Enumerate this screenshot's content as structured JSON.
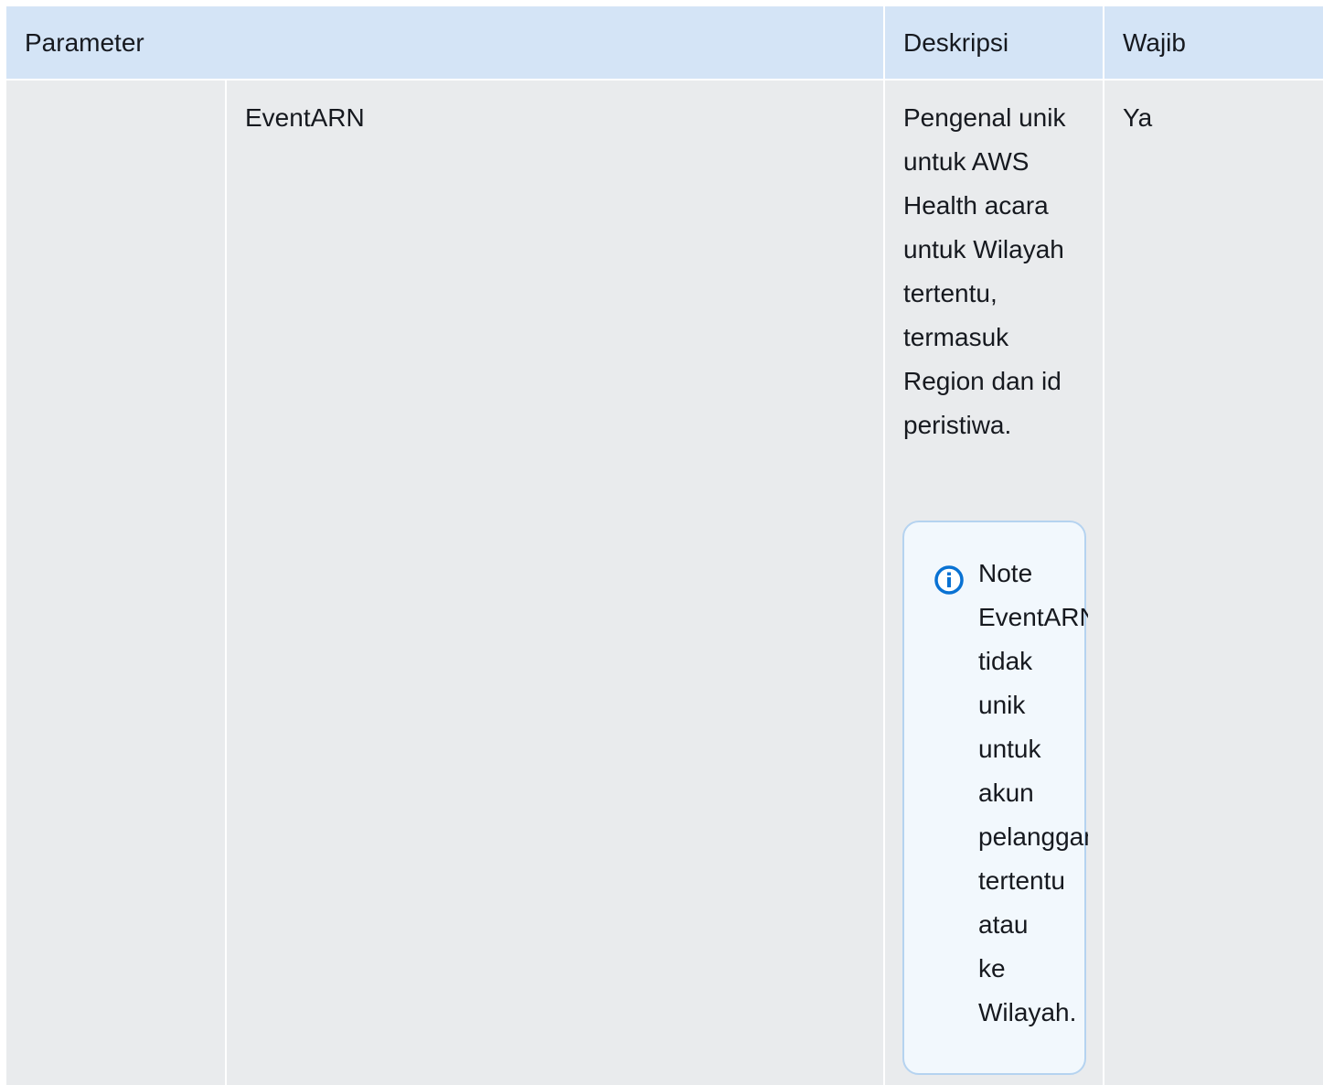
{
  "table": {
    "headers": {
      "parameter": "Parameter",
      "description": "Deskripsi",
      "required": "Wajib"
    },
    "rows": [
      {
        "name": "EventARN",
        "description": "Pengenal unik untuk AWS Health acara untuk Wilayah tertentu, termasuk Region dan id peristiwa.",
        "required": "Ya",
        "note": {
          "title": "Note",
          "icon": "info-icon",
          "lines": [
            "EventARN",
            "tidak",
            "unik",
            "untuk",
            "akun",
            "pelanggan",
            "tertentu",
            "atau",
            "ke",
            "Wilayah."
          ]
        }
      }
    ]
  },
  "colors": {
    "header_bg": "#d4e4f6",
    "row_bg": "#e9ebed",
    "note_bg": "#f2f8fd",
    "note_border": "#b5d3f0",
    "info_icon": "#0972d3"
  }
}
